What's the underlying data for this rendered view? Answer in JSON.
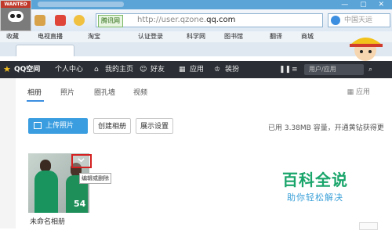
{
  "browser": {
    "badge": "WANTED",
    "address_engine": "腾讯网",
    "address_url_prefix": "http://user.qzone.",
    "address_url_domain": "qq.com",
    "search_placeholder": "中国天运",
    "favorites": [
      "收藏",
      "电视直播",
      "淘宝",
      "认证登录",
      "科学网",
      "图书馆",
      "翻译",
      "商城"
    ]
  },
  "qzone_nav": {
    "logo": "QQ空间",
    "items": [
      "个人中心",
      "我的主页",
      "好友",
      "应用",
      "装扮"
    ],
    "search_placeholder": "用户/应用"
  },
  "album": {
    "tabs": [
      "相册",
      "照片",
      "圈孔墙",
      "视频"
    ],
    "app_link": "应用",
    "upload_label": "上传照片",
    "create_label": "创建相册",
    "display_label": "展示设置",
    "usage_text": "已用 3.38MB 容量，开通黄钻获得更",
    "tooltip": "编辑或删除",
    "photo_count": "54",
    "album_name": "未命名相册"
  },
  "watermark": {
    "line1": "百科全说",
    "line2": "助你轻松解决"
  }
}
